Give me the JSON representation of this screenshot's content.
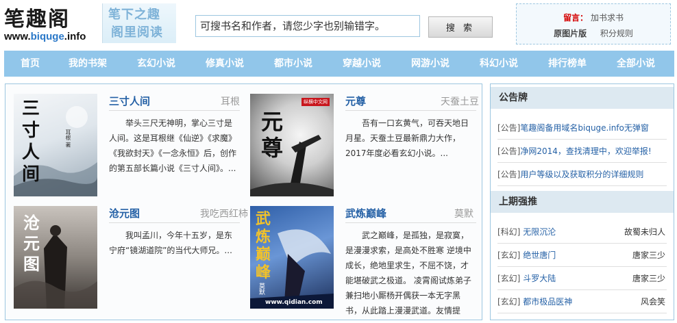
{
  "logo": {
    "title": "笔趣阁",
    "domain_prefix": "www.",
    "domain_accent": "biquge",
    "domain_suffix": ".info",
    "slogan_1": "笔下之趣",
    "slogan_2": "阁里阅读"
  },
  "search": {
    "placeholder": "可搜书名和作者，请您少字也别输错字。",
    "button_label": "搜 索"
  },
  "header_links": {
    "notice_label": "留言：",
    "notice_link": "加书求书",
    "original_version": "原图片版",
    "points_rules": "积分规则"
  },
  "nav": {
    "items": [
      "首页",
      "我的书架",
      "玄幻小说",
      "修真小说",
      "都市小说",
      "穿越小说",
      "网游小说",
      "科幻小说",
      "排行榜单",
      "全部小说"
    ]
  },
  "books": [
    {
      "title": "三寸人间",
      "author": "耳根",
      "description": "举头三尺无神明，掌心三寸是人间。这是耳根继《仙逆》《求魔》《我欲封天》《一念永恒》后，创作的第五部长篇小说《三寸人间》。...",
      "cover_text": "三寸人间",
      "cover_sub": "耳根 著"
    },
    {
      "title": "元尊",
      "author": "天蚕土豆",
      "description": "吾有一口玄黄气，可吞天地日月星。天蚕土豆最新鼎力大作，2017年度必看玄幻小说。...",
      "cover_text": "元尊",
      "cover_badge": "纵横中文网"
    },
    {
      "title": "沧元图",
      "author": "我吃西红柿",
      "description": "我叫孟川，今年十五岁，是东宁府“镜湖道院”的当代大师兄。...",
      "cover_text": "沧元图"
    },
    {
      "title": "武炼巅峰",
      "author": "莫默",
      "description": "武之巅峰，是孤独，是寂寞，是漫漫求索，是高处不胜寒 逆境中成长，绝地里求生，不屈不饶，才能堪破武之极道。 凌霄阁试炼弟子兼扫地小厮杨开偶获一本无字黑书，从此踏上漫漫武道。友情提",
      "cover_text": "武炼巅峰",
      "cover_author": "莫默",
      "cover_site": "www.qidian.com"
    }
  ],
  "sidebar": {
    "notice_title": "公告牌",
    "notices": [
      {
        "tag": "[公告]",
        "text": "笔趣阁备用域名biquge.info无弹窗"
      },
      {
        "tag": "[公告]",
        "text": "净网2014，查找清理中，欢迎举报!"
      },
      {
        "tag": "[公告]",
        "text": "用户等级以及获取积分的详细规则"
      }
    ],
    "top_title": "上期强推",
    "top_list": [
      {
        "tag": "[科幻]",
        "title": "无限沉沦",
        "author": "故蜀未归人"
      },
      {
        "tag": "[玄幻]",
        "title": "绝世唐门",
        "author": "唐家三少"
      },
      {
        "tag": "[玄幻]",
        "title": "斗罗大陆",
        "author": "唐家三少"
      },
      {
        "tag": "[玄幻]",
        "title": "都市极品医神",
        "author": "风会笑"
      }
    ]
  },
  "colors": {
    "nav_bg": "#91c6ea",
    "link_blue": "#2561a6",
    "accent_red": "#d40000"
  }
}
